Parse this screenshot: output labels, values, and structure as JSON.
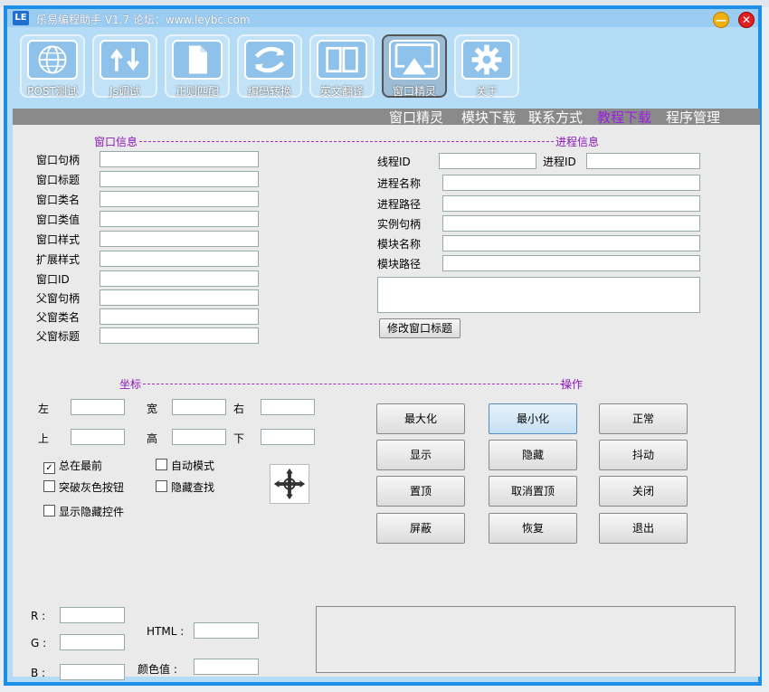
{
  "window": {
    "title": "乐易编程助手 V1.7 论坛：www.leybc.com",
    "logo": "LE",
    "minimize_glyph": "—",
    "close_glyph": "✕"
  },
  "toolbar": [
    {
      "label": "POST测试",
      "icon": "globe-icon"
    },
    {
      "label": "Js调试",
      "icon": "js-arrows-icon"
    },
    {
      "label": "正则匹配",
      "icon": "document-icon"
    },
    {
      "label": "编码转换",
      "icon": "convert-arrows-icon"
    },
    {
      "label": "英文翻译",
      "icon": "book-icon"
    },
    {
      "label": "窗口精灵",
      "icon": "screen-icon",
      "active": true
    },
    {
      "label": "关于",
      "icon": "gear-icon"
    }
  ],
  "nav": [
    "窗口精灵",
    "模块下载",
    "联系方式",
    "教程下载",
    "程序管理"
  ],
  "window_info": {
    "title": "窗口信息",
    "fields": [
      "窗口句柄",
      "窗口标题",
      "窗口类名",
      "窗口类值",
      "窗口样式",
      "扩展样式",
      "窗口ID",
      "父窗句柄",
      "父窗类名",
      "父窗标题"
    ]
  },
  "process_info": {
    "title": "进程信息",
    "thread_id_label": "线程ID",
    "process_id_label": "进程ID",
    "fields": [
      "进程名称",
      "进程路径",
      "实例句柄",
      "模块名称",
      "模块路径"
    ],
    "modify_title_button": "修改窗口标题"
  },
  "coords": {
    "title": "坐标",
    "left": "左",
    "width": "宽",
    "right": "右",
    "top": "上",
    "height": "高",
    "bottom": "下"
  },
  "options": {
    "always_on_top": "总在最前",
    "auto_mode": "自动模式",
    "break_gray_button": "突破灰色按钮",
    "hide_find": "隐藏查找",
    "show_hidden_controls": "显示隐藏控件",
    "check_mark": "✓"
  },
  "operations": {
    "title": "操作",
    "buttons": [
      "最大化",
      "最小化",
      "正常",
      "显示",
      "隐藏",
      "抖动",
      "置顶",
      "取消置顶",
      "关闭",
      "屏蔽",
      "恢复",
      "退出"
    ]
  },
  "color": {
    "r": "R :",
    "g": "G :",
    "b": "B :",
    "html": "HTML :",
    "value": "颜色值 :"
  }
}
